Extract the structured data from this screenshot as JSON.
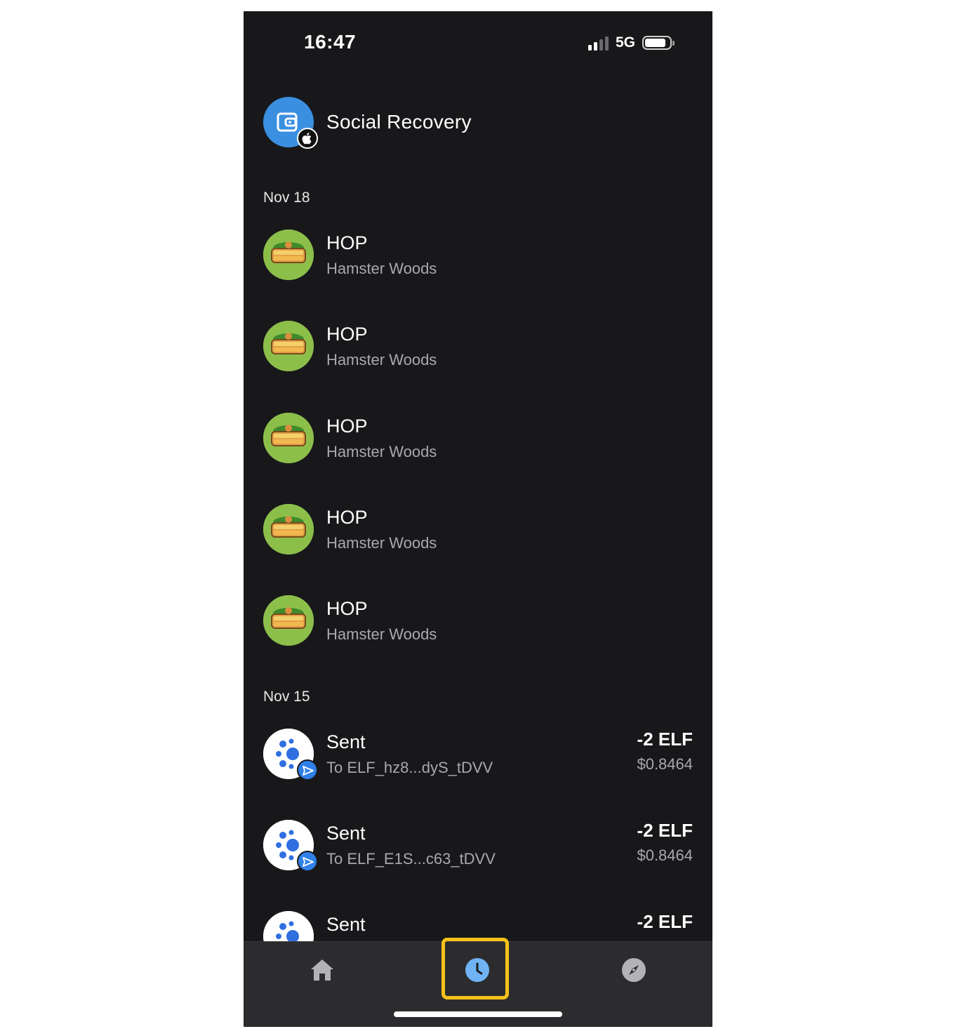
{
  "status_bar": {
    "time": "16:47",
    "network": "5G"
  },
  "header": {
    "title": "Social Recovery"
  },
  "groups": [
    {
      "date": "Nov 18",
      "items": [
        {
          "title": "HOP",
          "subtitle": "Hamster Woods"
        },
        {
          "title": "HOP",
          "subtitle": "Hamster Woods"
        },
        {
          "title": "HOP",
          "subtitle": "Hamster Woods"
        },
        {
          "title": "HOP",
          "subtitle": "Hamster Woods"
        },
        {
          "title": "HOP",
          "subtitle": "Hamster Woods"
        }
      ]
    },
    {
      "date": "Nov 15",
      "items": [
        {
          "title": "Sent",
          "subtitle": "To ELF_hz8...dyS_tDVV",
          "amount": "-2 ELF",
          "fiat": "$0.8464"
        },
        {
          "title": "Sent",
          "subtitle": "To ELF_E1S...c63_tDVV",
          "amount": "-2 ELF",
          "fiat": "$0.8464"
        },
        {
          "title": "Sent",
          "amount": "-2 ELF"
        }
      ]
    }
  ],
  "tabbar": {
    "tabs": [
      {
        "icon": "home-icon",
        "active": false
      },
      {
        "icon": "clock-icon",
        "active": true
      },
      {
        "icon": "compass-icon",
        "active": false
      }
    ],
    "active_color": "#6fb3f5",
    "highlight_color": "#f6c21a"
  },
  "colors": {
    "background": "#18181b",
    "accent": "#3b8fe0"
  }
}
